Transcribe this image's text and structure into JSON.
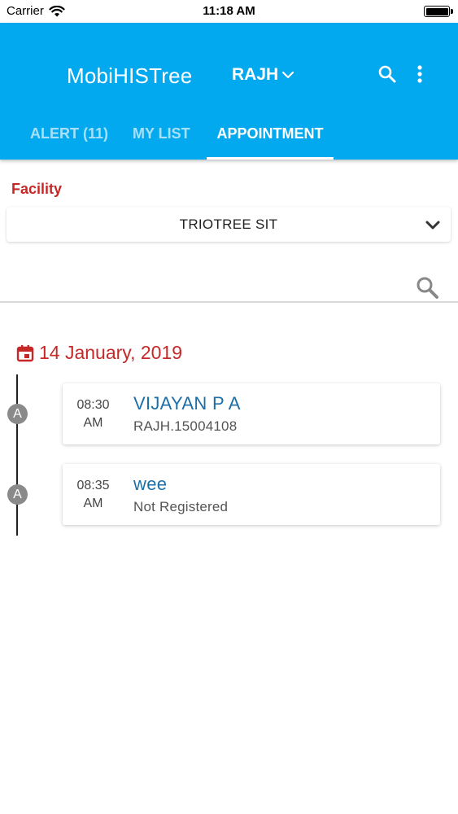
{
  "status_bar": {
    "carrier": "Carrier",
    "time": "11:18 AM"
  },
  "header": {
    "app_title": "MobiHISTree",
    "hospital": "RAJH",
    "background_color": "#03a9ee"
  },
  "tabs": [
    {
      "label": "ALERT (11)",
      "active": false
    },
    {
      "label": "MY LIST",
      "active": false
    },
    {
      "label": "APPOINTMENT",
      "active": true
    }
  ],
  "facility": {
    "label": "Facility",
    "selected": "TRIOTREE SIT"
  },
  "search": {
    "placeholder": ""
  },
  "date": "14 January, 2019",
  "appointments": [
    {
      "badge": "A",
      "time": "08:30",
      "meridiem": "AM",
      "name": "VIJAYAN P A",
      "detail": "RAJH.15004108"
    },
    {
      "badge": "A",
      "time": "08:35",
      "meridiem": "AM",
      "name": "wee",
      "detail": "Not Registered"
    }
  ],
  "colors": {
    "accent_red": "#c62828",
    "link_blue": "#1c6fa8"
  }
}
